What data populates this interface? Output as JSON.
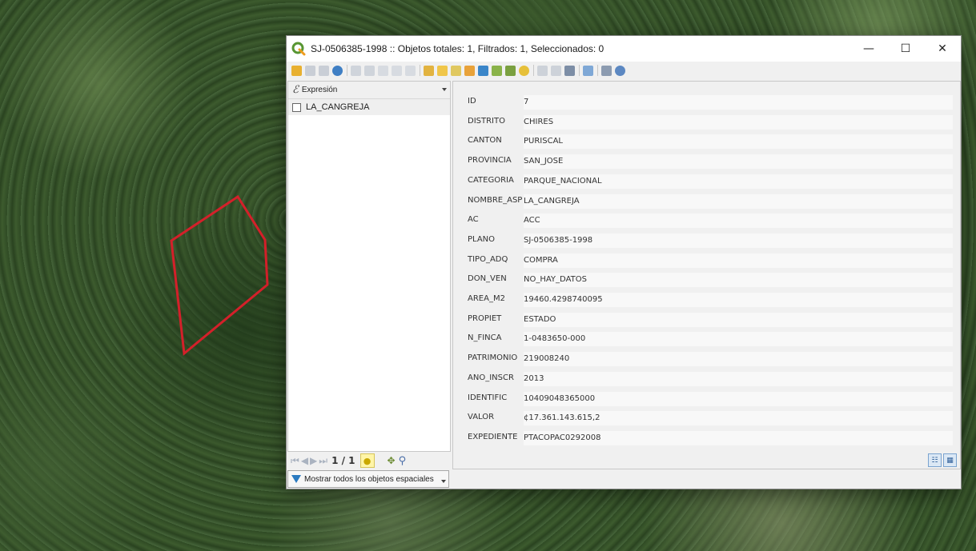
{
  "window": {
    "title": "SJ-0506385-1998 :: Objetos totales: 1, Filtrados: 1, Seleccionados: 0",
    "minimize": "—",
    "maximize": "☐",
    "close": "✕"
  },
  "colors": {
    "polygon_stroke": "#d4202a",
    "qgis_green": "#589632",
    "window_bg": "#f0f0f0"
  },
  "toolbar": {
    "icons": [
      "pencil-icon",
      "save-icon",
      "save-all-icon",
      "reload-icon",
      "copy-icon",
      "delete-icon",
      "cut-icon",
      "paste-icon",
      "new-field-icon",
      "select-by-expression-icon",
      "select-all-icon",
      "invert-selection-icon",
      "deselect-icon",
      "filter-icon",
      "move-selection-icon",
      "pan-to-selection-icon",
      "zoom-to-selection-icon",
      "copy-rows-icon",
      "paste-rows-icon",
      "field-calculator-icon",
      "conditional-format-icon",
      "actions-icon",
      "dock-icon"
    ]
  },
  "left_pane": {
    "expression_icon": "ℰ",
    "expression_label": "Expresión",
    "feature_label": "LA_CANGREJA",
    "page_indicator": "1 / 1",
    "filter_label": "Mostrar todos los objetos espaciales"
  },
  "fields": [
    {
      "label": "ID",
      "value": "7"
    },
    {
      "label": "DISTRITO",
      "value": "CHIRES"
    },
    {
      "label": "CANTON",
      "value": "PURISCAL"
    },
    {
      "label": "PROVINCIA",
      "value": "SAN_JOSE"
    },
    {
      "label": "CATEGORIA",
      "value": "PARQUE_NACIONAL"
    },
    {
      "label": "NOMBRE_ASP",
      "value": "LA_CANGREJA"
    },
    {
      "label": "AC",
      "value": "ACC"
    },
    {
      "label": "PLANO",
      "value": "SJ-0506385-1998"
    },
    {
      "label": "TIPO_ADQ",
      "value": "COMPRA"
    },
    {
      "label": "DON_VEN",
      "value": "NO_HAY_DATOS"
    },
    {
      "label": "AREA_M2",
      "value": "19460.4298740095"
    },
    {
      "label": "PROPIET",
      "value": "ESTADO"
    },
    {
      "label": "N_FINCA",
      "value": "1-0483650-000"
    },
    {
      "label": "PATRIMONIO",
      "value": "219008240"
    },
    {
      "label": "ANO_INSCR",
      "value": "2013"
    },
    {
      "label": "IDENTIFIC",
      "value": "10409048365000"
    },
    {
      "label": "VALOR",
      "value": "¢17.361.143.615,2"
    },
    {
      "label": "EXPEDIENTE",
      "value": "PTACOPAC0292008"
    }
  ]
}
